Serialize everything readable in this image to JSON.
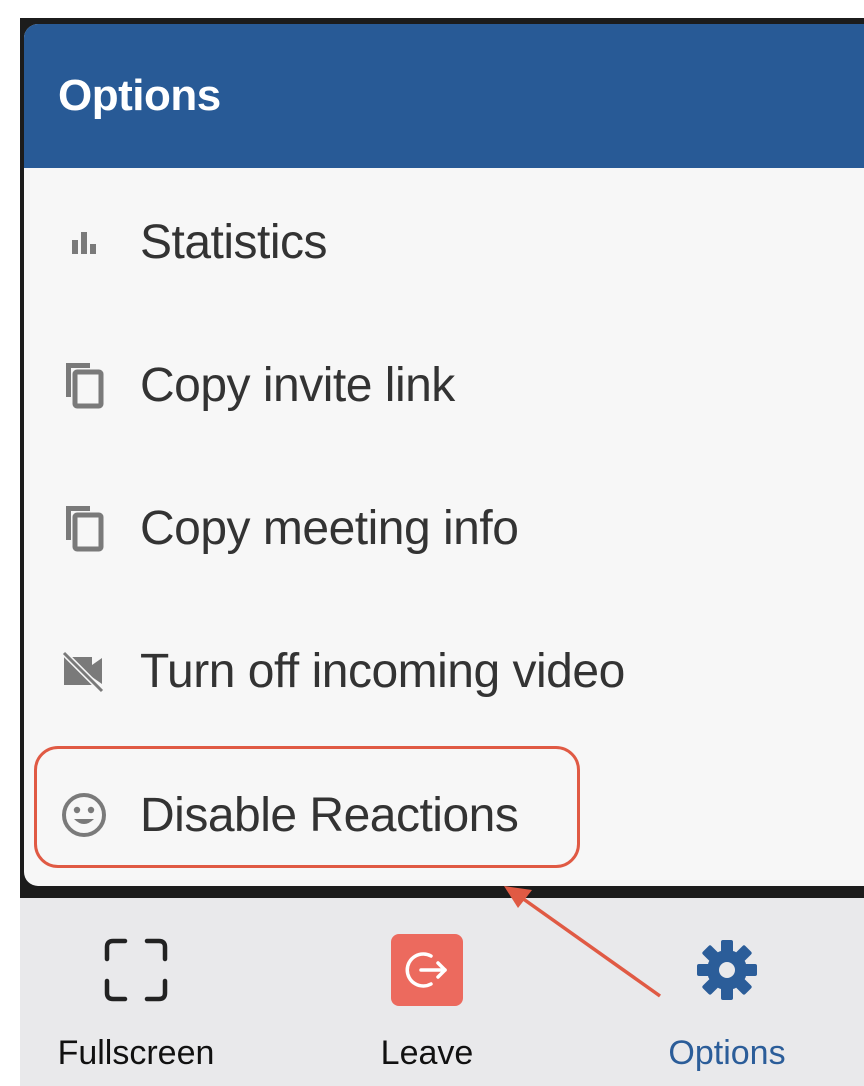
{
  "options_panel": {
    "title": "Options",
    "items": [
      {
        "label": "Statistics",
        "icon": "bar-chart-icon"
      },
      {
        "label": "Copy invite link",
        "icon": "copy-icon"
      },
      {
        "label": "Copy meeting info",
        "icon": "copy-icon"
      },
      {
        "label": "Turn off incoming video",
        "icon": "video-off-icon"
      },
      {
        "label": "Disable Reactions",
        "icon": "smiley-icon"
      }
    ]
  },
  "toolbar": {
    "fullscreen_label": "Fullscreen",
    "leave_label": "Leave",
    "options_label": "Options"
  },
  "colors": {
    "header": "#285a96",
    "leave_button": "#ec6a5e",
    "active_tool": "#2b5d99",
    "annotation": "#e05a44"
  }
}
